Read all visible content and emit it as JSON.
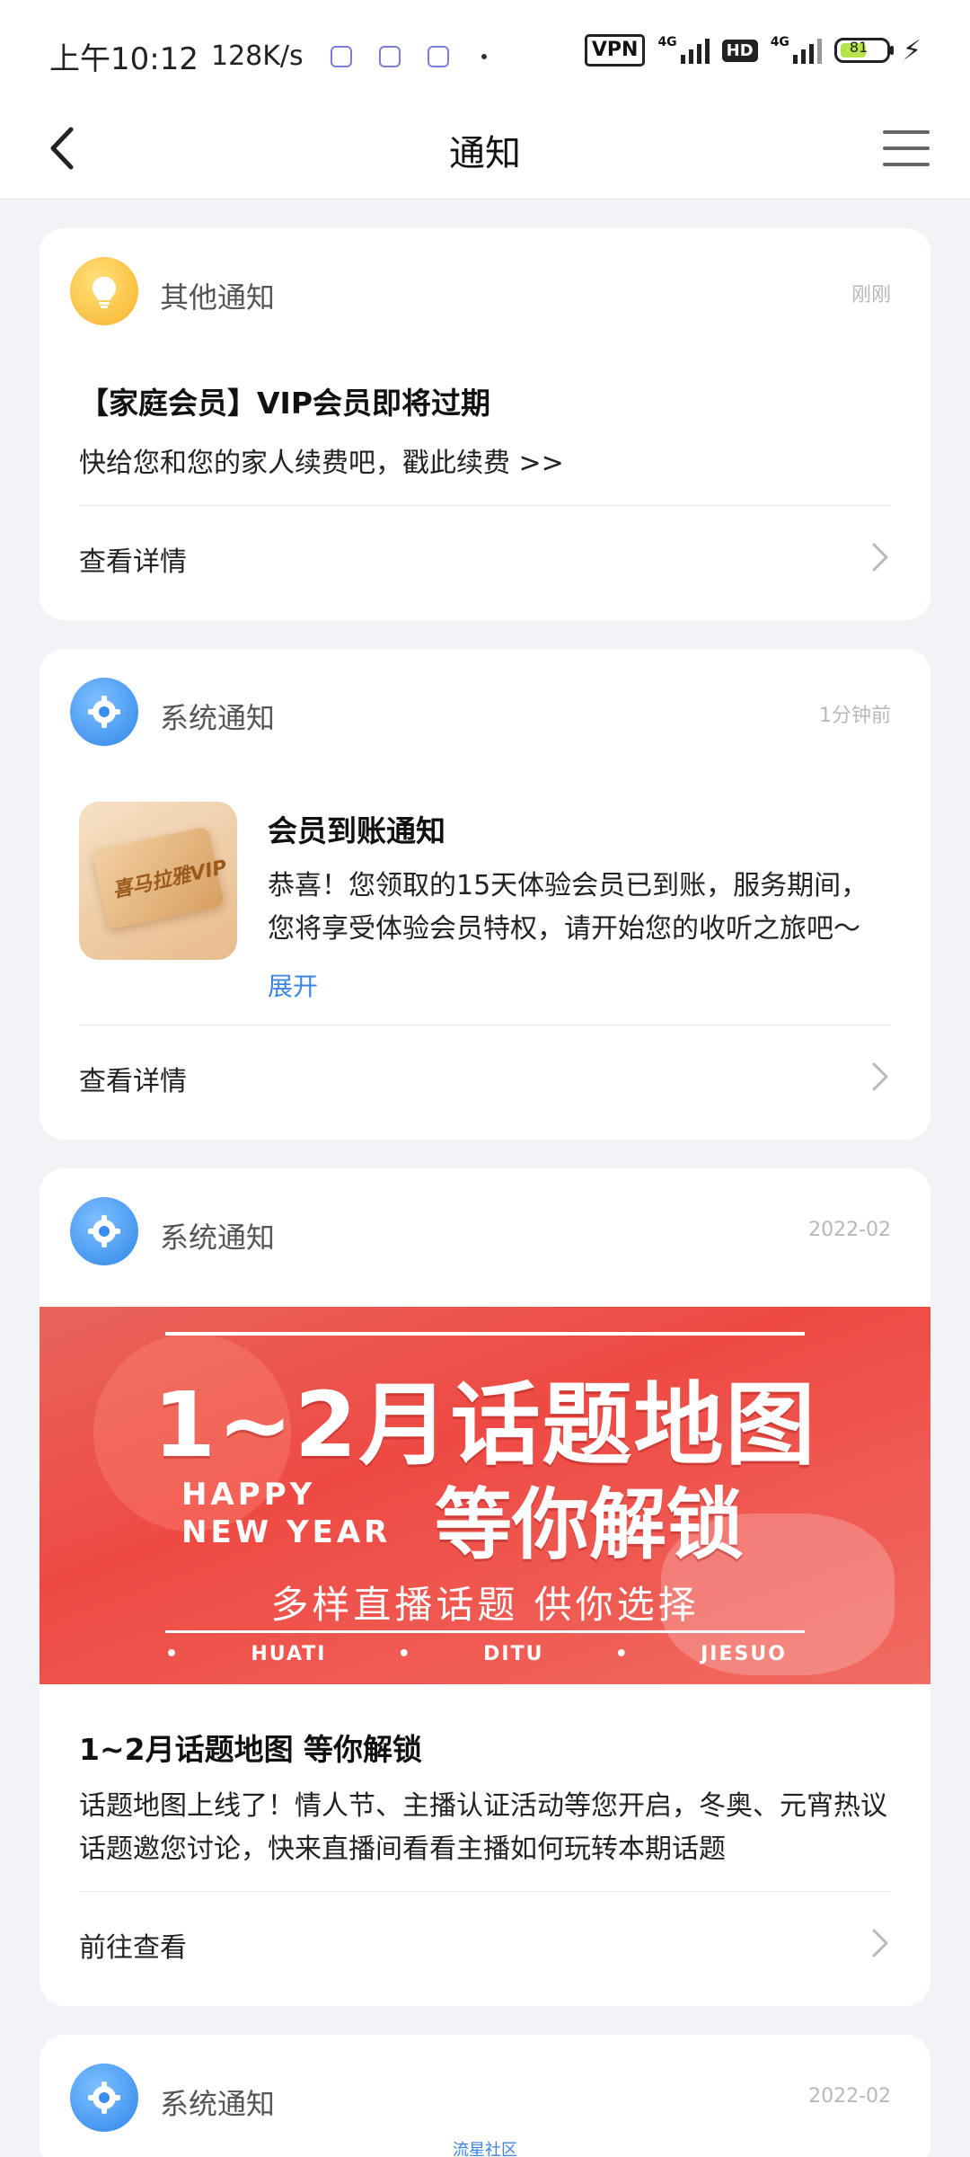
{
  "status_bar": {
    "time": "上午10:12",
    "speed": "128K/s",
    "vpn": "VPN",
    "net1": "4G",
    "hd": "HD",
    "net2": "4G",
    "battery": "81"
  },
  "header": {
    "title": "通知",
    "back_icon": "back-arrow-icon",
    "menu_icon": "hamburger-menu-icon"
  },
  "cards": [
    {
      "sender": "其他通知",
      "time": "刚刚",
      "title": "【家庭会员】VIP会员即将过期",
      "body": "快给您和您的家人续费吧，戳此续费 >>",
      "action": "查看详情",
      "avatar_icon": "lightbulb-icon"
    },
    {
      "sender": "系统通知",
      "time": "1分钟前",
      "title": "会员到账通知",
      "body": "恭喜！您领取的15天体验会员已到账，服务期间，您将享受体验会员特权，请开始您的收听之旅吧～",
      "expand": "展开",
      "thumb_text": "喜马拉雅VIP",
      "action": "查看详情",
      "avatar_icon": "gear-icon"
    },
    {
      "sender": "系统通知",
      "time": "2022-02",
      "banner": {
        "headline": "1~2月话题地图",
        "happy": "HAPPY",
        "new_year": "NEW YEAR",
        "unlock": "等你解锁",
        "sub": "多样直播话题  供你选择",
        "k1": "HUATI",
        "k2": "DITU",
        "k3": "JIESUO"
      },
      "title": "1~2月话题地图 等你解锁",
      "body": "话题地图上线了！情人节、主播认证活动等您开启，冬奥、元宵热议话题邀您讨论，快来直播间看看主播如何玩转本期话题",
      "action": "前往查看",
      "avatar_icon": "gear-icon"
    },
    {
      "sender": "系统通知",
      "time": "2022-02",
      "footer": "流星社区",
      "avatar_icon": "gear-icon"
    }
  ]
}
